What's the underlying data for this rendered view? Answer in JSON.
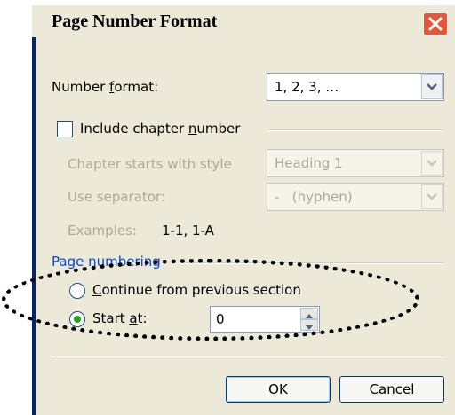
{
  "window": {
    "title": "Page Number Format"
  },
  "number_format": {
    "label_pre": "Number ",
    "label_key": "f",
    "label_post": "ormat:",
    "value": "1, 2, 3, …"
  },
  "include_chapter": {
    "label_pre": "Include chapter ",
    "label_key": "n",
    "label_post": "umber",
    "checked": false
  },
  "chapter_style": {
    "label": "Chapter starts with style",
    "value": "Heading 1"
  },
  "separator": {
    "label": "Use separator:",
    "value": "-   (hyphen)"
  },
  "examples": {
    "label": "Examples:",
    "value": "1-1, 1-A"
  },
  "page_numbering": {
    "heading": "Page numbering",
    "continue_pre": "",
    "continue_key": "C",
    "continue_post": "ontinue from previous section",
    "start_pre": "Start ",
    "start_key": "a",
    "start_post": "t:",
    "start_value": "0",
    "selected": "start_at"
  },
  "buttons": {
    "ok": "OK",
    "cancel": "Cancel"
  },
  "colors": {
    "accent_blue": "#0046d5",
    "close_red": "#e6563a",
    "radio_green": "#21a121"
  }
}
